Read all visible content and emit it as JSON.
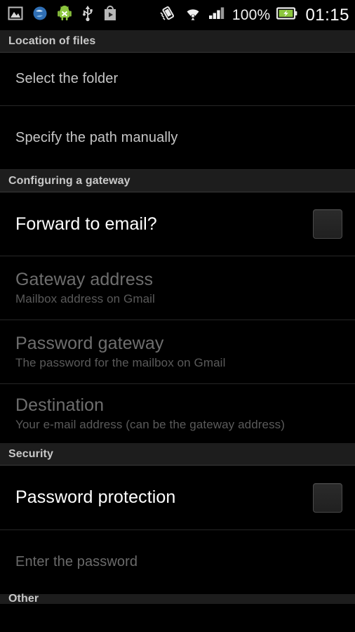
{
  "statusbar": {
    "icons_left": [
      "image-icon",
      "browser-globe-icon",
      "android-robot-icon",
      "usb-icon",
      "play-store-bag-icon"
    ],
    "icons_right": [
      "vibrate-icon",
      "wifi-icon",
      "cellular-signal-icon"
    ],
    "battery_percent": "100%",
    "battery_icon": "battery-charging-icon",
    "clock": "01:15",
    "accent_green": "#8cc63e"
  },
  "sections": [
    {
      "header": "Location of files",
      "rows": [
        {
          "title": "Select the folder",
          "sub": "",
          "style": "small",
          "disabled": false,
          "checkbox": false
        },
        {
          "title": "Specify the path manually",
          "sub": "",
          "style": "small",
          "disabled": false,
          "checkbox": false
        }
      ]
    },
    {
      "header": "Configuring a gateway",
      "rows": [
        {
          "title": "Forward to email?",
          "sub": "",
          "style": "large",
          "disabled": false,
          "checkbox": true,
          "checked": false
        },
        {
          "title": "Gateway address",
          "sub": "Mailbox address on Gmail",
          "style": "large",
          "disabled": true,
          "checkbox": false
        },
        {
          "title": "Password gateway",
          "sub": "The password for the mailbox on Gmail",
          "style": "large",
          "disabled": true,
          "checkbox": false
        },
        {
          "title": "Destination",
          "sub": "Your e-mail address (can be the gateway address)",
          "style": "large",
          "disabled": true,
          "checkbox": false
        }
      ]
    },
    {
      "header": "Security",
      "rows": [
        {
          "title": "Password protection",
          "sub": "",
          "style": "large",
          "disabled": false,
          "checkbox": true,
          "checked": false
        },
        {
          "title": "Enter the password",
          "sub": "",
          "style": "small",
          "disabled": true,
          "checkbox": false
        }
      ]
    },
    {
      "header": "Other",
      "partial": true,
      "rows": []
    }
  ]
}
